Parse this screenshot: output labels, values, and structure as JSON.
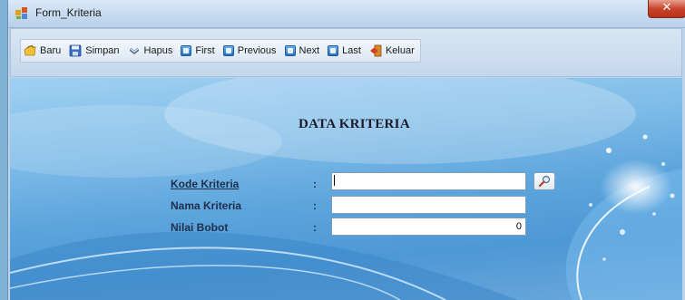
{
  "window": {
    "title": "Form_Kriteria",
    "close_label": "✕"
  },
  "toolbar": {
    "items": [
      {
        "label": "Baru",
        "icon": "new-document-icon"
      },
      {
        "label": "Simpan",
        "icon": "save-disk-icon"
      },
      {
        "label": "Hapus",
        "icon": "delete-icon"
      },
      {
        "label": "First",
        "icon": "first-record-icon"
      },
      {
        "label": "Previous",
        "icon": "previous-record-icon"
      },
      {
        "label": "Next",
        "icon": "next-record-icon"
      },
      {
        "label": "Last",
        "icon": "last-record-icon"
      },
      {
        "label": "Keluar",
        "icon": "exit-door-icon"
      }
    ]
  },
  "form": {
    "title": "DATA KRITERIA",
    "fields": [
      {
        "label": "Kode Kriteria",
        "colon": ":",
        "value": ""
      },
      {
        "label": "Nama Kriteria",
        "colon": ":",
        "value": ""
      },
      {
        "label": "Nilai Bobot",
        "colon": ":",
        "value": "0"
      }
    ],
    "search_icon": "search-magnifier-icon"
  },
  "colors": {
    "panel_blue": "#5ba4dc",
    "label_text": "#1f2d4a",
    "close_red": "#c9442c"
  }
}
